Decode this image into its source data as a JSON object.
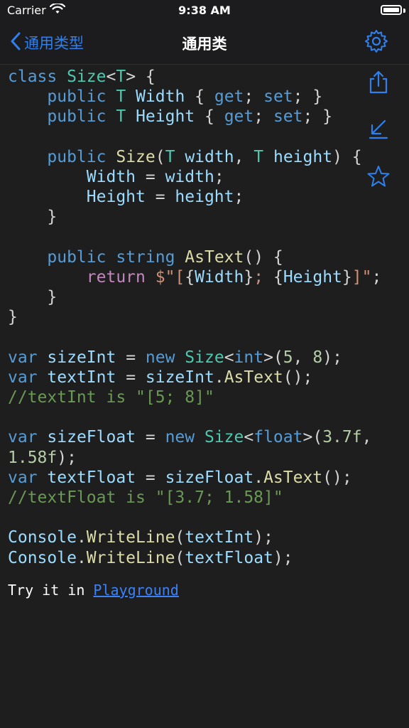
{
  "status_bar": {
    "carrier": "Carrier",
    "time": "9:38 AM"
  },
  "nav": {
    "back_label": "通用类型",
    "title": "通用类"
  },
  "code_lines": [
    [
      [
        "kw",
        "class"
      ],
      [
        "plain",
        " "
      ],
      [
        "tp",
        "Size"
      ],
      [
        "plain",
        "<"
      ],
      [
        "tp",
        "T"
      ],
      [
        "plain",
        "> {"
      ]
    ],
    [
      [
        "plain",
        "    "
      ],
      [
        "kw",
        "public"
      ],
      [
        "plain",
        " "
      ],
      [
        "tp",
        "T"
      ],
      [
        "plain",
        " "
      ],
      [
        "var",
        "Width"
      ],
      [
        "plain",
        " { "
      ],
      [
        "kw",
        "get"
      ],
      [
        "plain",
        "; "
      ],
      [
        "kw",
        "set"
      ],
      [
        "plain",
        "; }"
      ]
    ],
    [
      [
        "plain",
        "    "
      ],
      [
        "kw",
        "public"
      ],
      [
        "plain",
        " "
      ],
      [
        "tp",
        "T"
      ],
      [
        "plain",
        " "
      ],
      [
        "var",
        "Height"
      ],
      [
        "plain",
        " { "
      ],
      [
        "kw",
        "get"
      ],
      [
        "plain",
        "; "
      ],
      [
        "kw",
        "set"
      ],
      [
        "plain",
        "; }"
      ]
    ],
    [
      [
        "plain",
        ""
      ]
    ],
    [
      [
        "plain",
        "    "
      ],
      [
        "kw",
        "public"
      ],
      [
        "plain",
        " "
      ],
      [
        "fn",
        "Size"
      ],
      [
        "plain",
        "("
      ],
      [
        "tp",
        "T"
      ],
      [
        "plain",
        " "
      ],
      [
        "var",
        "width"
      ],
      [
        "plain",
        ", "
      ],
      [
        "tp",
        "T"
      ],
      [
        "plain",
        " "
      ],
      [
        "var",
        "height"
      ],
      [
        "plain",
        ") {"
      ]
    ],
    [
      [
        "plain",
        "        "
      ],
      [
        "var",
        "Width"
      ],
      [
        "plain",
        " = "
      ],
      [
        "var",
        "width"
      ],
      [
        "plain",
        ";"
      ]
    ],
    [
      [
        "plain",
        "        "
      ],
      [
        "var",
        "Height"
      ],
      [
        "plain",
        " = "
      ],
      [
        "var",
        "height"
      ],
      [
        "plain",
        ";"
      ]
    ],
    [
      [
        "plain",
        "    }"
      ]
    ],
    [
      [
        "plain",
        ""
      ]
    ],
    [
      [
        "plain",
        "    "
      ],
      [
        "kw",
        "public"
      ],
      [
        "plain",
        " "
      ],
      [
        "kw",
        "string"
      ],
      [
        "plain",
        " "
      ],
      [
        "fn",
        "AsText"
      ],
      [
        "plain",
        "() {"
      ]
    ],
    [
      [
        "plain",
        "        "
      ],
      [
        "ctrl",
        "return"
      ],
      [
        "plain",
        " "
      ],
      [
        "str",
        "$\"["
      ],
      [
        "plain",
        "{"
      ],
      [
        "var",
        "Width"
      ],
      [
        "plain",
        "}"
      ],
      [
        "str",
        "; "
      ],
      [
        "plain",
        "{"
      ],
      [
        "var",
        "Height"
      ],
      [
        "plain",
        "}"
      ],
      [
        "str",
        "]\""
      ],
      [
        "plain",
        ";"
      ]
    ],
    [
      [
        "plain",
        "    }"
      ]
    ],
    [
      [
        "plain",
        "}"
      ]
    ],
    [
      [
        "plain",
        ""
      ]
    ],
    [
      [
        "kw",
        "var"
      ],
      [
        "plain",
        " "
      ],
      [
        "var",
        "sizeInt"
      ],
      [
        "plain",
        " = "
      ],
      [
        "kw",
        "new"
      ],
      [
        "plain",
        " "
      ],
      [
        "tp",
        "Size"
      ],
      [
        "plain",
        "<"
      ],
      [
        "kw",
        "int"
      ],
      [
        "plain",
        ">("
      ],
      [
        "num",
        "5"
      ],
      [
        "plain",
        ", "
      ],
      [
        "num",
        "8"
      ],
      [
        "plain",
        ");"
      ]
    ],
    [
      [
        "kw",
        "var"
      ],
      [
        "plain",
        " "
      ],
      [
        "var",
        "textInt"
      ],
      [
        "plain",
        " = "
      ],
      [
        "var",
        "sizeInt"
      ],
      [
        "plain",
        "."
      ],
      [
        "fn",
        "AsText"
      ],
      [
        "plain",
        "();"
      ]
    ],
    [
      [
        "comment",
        "//textInt is \"[5; 8]\""
      ]
    ],
    [
      [
        "plain",
        ""
      ]
    ],
    [
      [
        "kw",
        "var"
      ],
      [
        "plain",
        " "
      ],
      [
        "var",
        "sizeFloat"
      ],
      [
        "plain",
        " = "
      ],
      [
        "kw",
        "new"
      ],
      [
        "plain",
        " "
      ],
      [
        "tp",
        "Size"
      ],
      [
        "plain",
        "<"
      ],
      [
        "kw",
        "float"
      ],
      [
        "plain",
        ">("
      ],
      [
        "num",
        "3.7f"
      ],
      [
        "plain",
        ","
      ]
    ],
    [
      [
        "num",
        "1.58f"
      ],
      [
        "plain",
        ");"
      ]
    ],
    [
      [
        "kw",
        "var"
      ],
      [
        "plain",
        " "
      ],
      [
        "var",
        "textFloat"
      ],
      [
        "plain",
        " = "
      ],
      [
        "var",
        "sizeFloat"
      ],
      [
        "plain",
        "."
      ],
      [
        "fn",
        "AsText"
      ],
      [
        "plain",
        "();"
      ]
    ],
    [
      [
        "comment",
        "//textFloat is \"[3.7; 1.58]\""
      ]
    ],
    [
      [
        "plain",
        ""
      ]
    ],
    [
      [
        "var",
        "Console"
      ],
      [
        "plain",
        "."
      ],
      [
        "fn",
        "WriteLine"
      ],
      [
        "plain",
        "("
      ],
      [
        "var",
        "textInt"
      ],
      [
        "plain",
        ");"
      ]
    ],
    [
      [
        "var",
        "Console"
      ],
      [
        "plain",
        "."
      ],
      [
        "fn",
        "WriteLine"
      ],
      [
        "plain",
        "("
      ],
      [
        "var",
        "textFloat"
      ],
      [
        "plain",
        ");"
      ]
    ]
  ],
  "footer": {
    "prefix": "Try it in ",
    "link_label": "Playground"
  },
  "icons": {
    "back": "chevron-left-icon",
    "settings": "gear-icon",
    "share": "share-icon",
    "collapse": "arrow-down-left-icon",
    "favorite": "star-icon"
  },
  "colors": {
    "background": "#1e1e1e",
    "accent": "#2f80ed",
    "keyword": "#569cd6",
    "comment": "#6a9955",
    "string": "#ce9178"
  }
}
